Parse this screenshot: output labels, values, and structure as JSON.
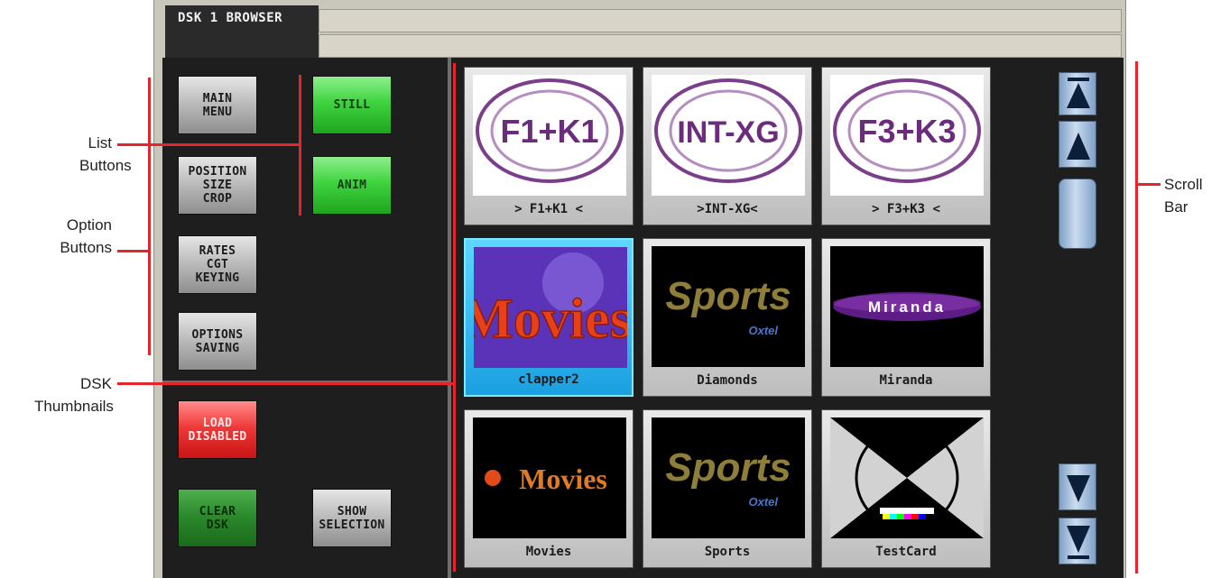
{
  "app": {
    "tab_title": "DSK 1 BROWSER"
  },
  "list_buttons": [
    {
      "label": "STILL"
    },
    {
      "label": "ANIM"
    }
  ],
  "option_buttons": [
    {
      "label": "MAIN\nMENU"
    },
    {
      "label": "POSITION\nSIZE\nCROP"
    },
    {
      "label": "RATES\nCGT\nKEYING"
    },
    {
      "label": "OPTIONS\nSAVING"
    }
  ],
  "action_buttons": {
    "load": "LOAD\nDISABLED",
    "clear": "CLEAR\nDSK",
    "show_selection": "SHOW\nSELECTION"
  },
  "thumbnails": [
    {
      "label": "> F1+K1 <",
      "image_text": "F1+K1",
      "selected": false
    },
    {
      "label": ">INT-XG<",
      "image_text": "INT-XG",
      "selected": false
    },
    {
      "label": "> F3+K3 <",
      "image_text": "F3+K3",
      "selected": false
    },
    {
      "label": "clapper2",
      "image_text": "Movies",
      "selected": true
    },
    {
      "label": "Diamonds",
      "image_text": "Sports",
      "image_subtext": "Oxtel",
      "selected": false
    },
    {
      "label": "Miranda",
      "image_text": "Miranda",
      "selected": false
    },
    {
      "label": "Movies",
      "image_text": "Movies",
      "selected": false
    },
    {
      "label": "Sports",
      "image_text": "Sports",
      "image_subtext": "Oxtel",
      "selected": false
    },
    {
      "label": "TestCard",
      "selected": false
    }
  ],
  "annotations": {
    "list_buttons": "List\nButtons",
    "option_buttons": "Option\nButtons",
    "dsk_thumbnails": "DSK\nThumbnails",
    "scroll_bar": "Scroll\nBar"
  },
  "colors": {
    "accent_green": "#3fd33f",
    "alert_red": "#f03a3a",
    "selected_blue": "#1b9fe0",
    "annotation_red": "#e5242c"
  }
}
